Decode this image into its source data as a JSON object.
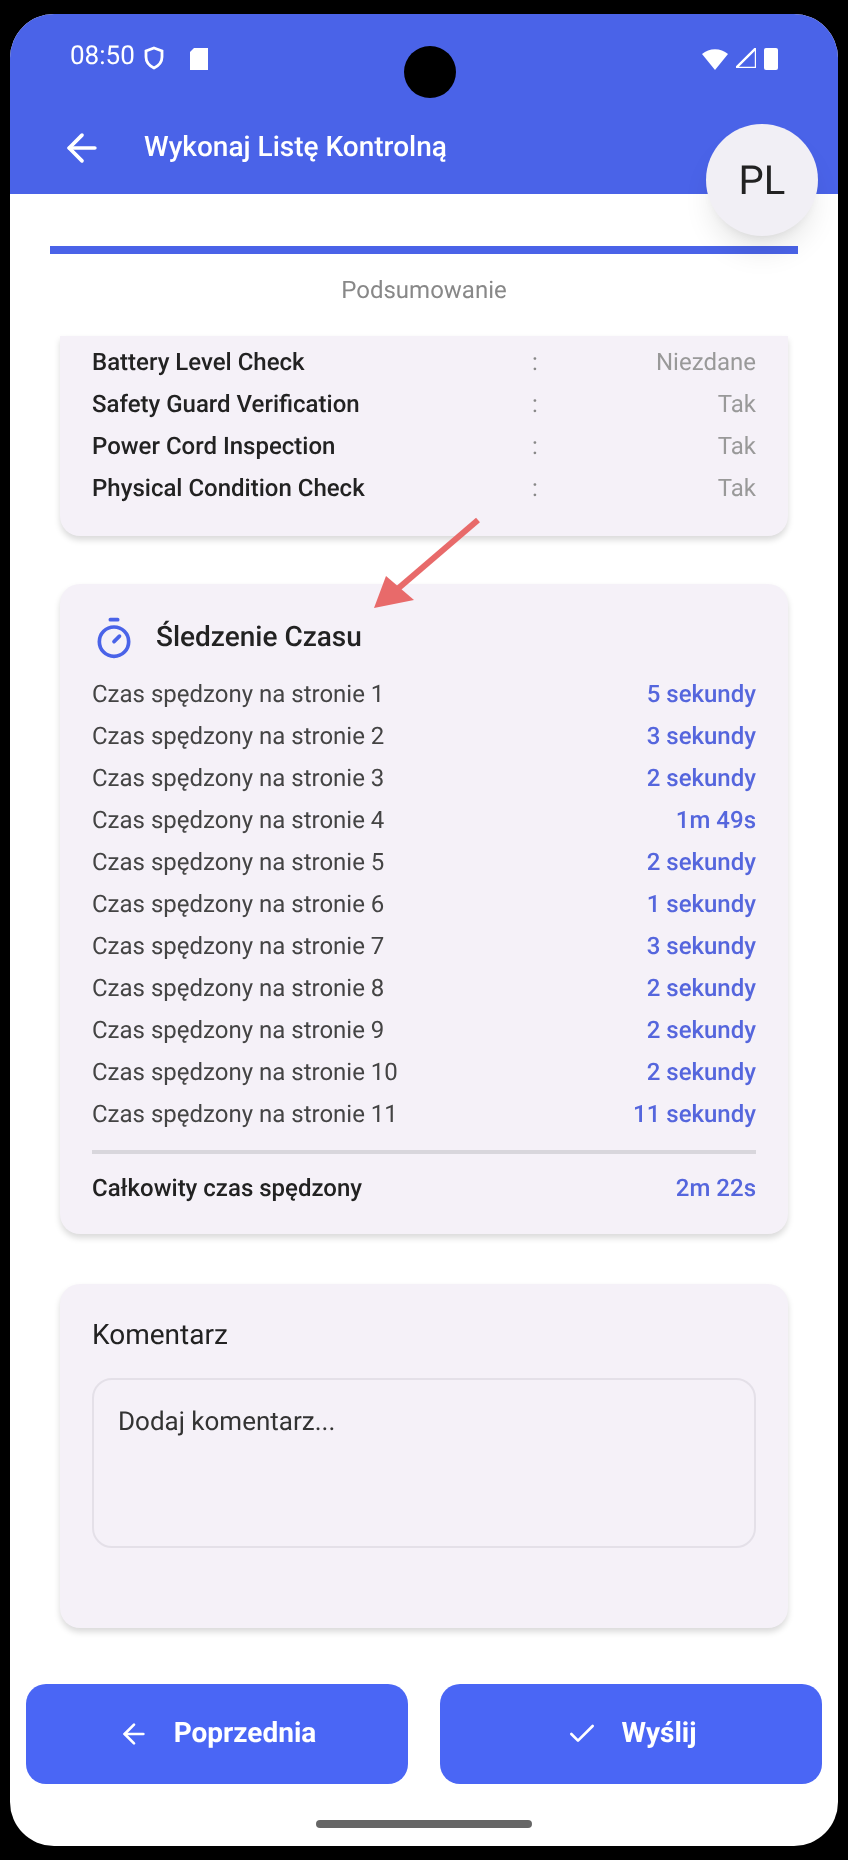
{
  "status_bar": {
    "time": "08:50"
  },
  "app_bar": {
    "title": "Wykonaj Listę Kontrolną",
    "avatar": "PL"
  },
  "progress": {
    "level": 1,
    "label": "Podsumowanie"
  },
  "checklist": [
    {
      "name": "Battery Level Check",
      "separator": ":",
      "value": "Niezdane"
    },
    {
      "name": "Safety Guard Verification",
      "separator": ":",
      "value": "Tak"
    },
    {
      "name": "Power Cord Inspection",
      "separator": ":",
      "value": "Tak"
    },
    {
      "name": "Physical Condition Check",
      "separator": ":",
      "value": "Tak"
    }
  ],
  "time_tracking": {
    "title": "Śledzenie Czasu",
    "rows": [
      {
        "label": "Czas spędzony na stronie 1",
        "value": "5 sekundy"
      },
      {
        "label": "Czas spędzony na stronie 2",
        "value": "3 sekundy"
      },
      {
        "label": "Czas spędzony na stronie 3",
        "value": "2 sekundy"
      },
      {
        "label": "Czas spędzony na stronie 4",
        "value": "1m 49s"
      },
      {
        "label": "Czas spędzony na stronie 5",
        "value": "2 sekundy"
      },
      {
        "label": "Czas spędzony na stronie 6",
        "value": "1 sekundy"
      },
      {
        "label": "Czas spędzony na stronie 7",
        "value": "3 sekundy"
      },
      {
        "label": "Czas spędzony na stronie 8",
        "value": "2 sekundy"
      },
      {
        "label": "Czas spędzony na stronie 9",
        "value": "2 sekundy"
      },
      {
        "label": "Czas spędzony na stronie 10",
        "value": "2 sekundy"
      },
      {
        "label": "Czas spędzony na stronie 11",
        "value": "11 sekundy"
      }
    ],
    "total_label": "Całkowity czas spędzony",
    "total_value": "2m 22s"
  },
  "comment": {
    "title": "Komentarz",
    "placeholder": "Dodaj komentarz..."
  },
  "buttons": [
    {
      "kind": "back",
      "label": "Poprzednia"
    },
    {
      "kind": "submit",
      "label": "Wyślij"
    }
  ]
}
